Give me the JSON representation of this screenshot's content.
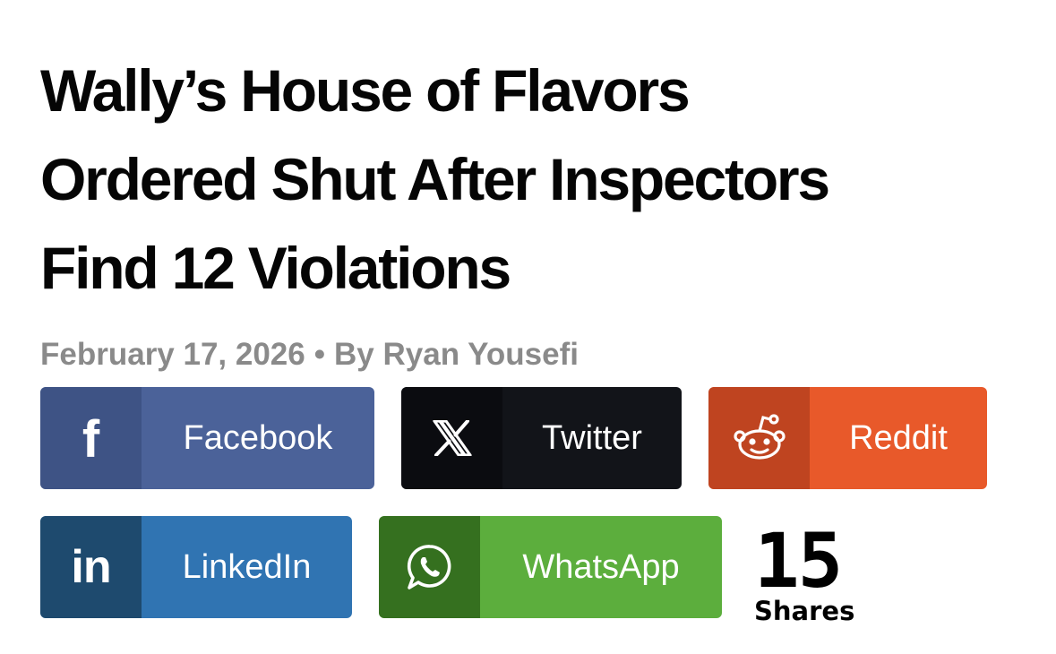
{
  "article": {
    "headline_lines": [
      "Wally’s House of Flavors",
      "Ordered Shut After Inspectors",
      "Find 12 Violations"
    ],
    "date": "February 17, 2026",
    "separator": "•",
    "byline": "By Ryan Yousefi"
  },
  "share": {
    "buttons": [
      {
        "label": "Facebook",
        "icon": "facebook-icon",
        "glyph": "f",
        "color": "#4b6299"
      },
      {
        "label": "Twitter",
        "icon": "x-twitter-icon",
        "color": "#121419"
      },
      {
        "label": "Reddit",
        "icon": "reddit-icon",
        "color": "#e8592a"
      },
      {
        "label": "LinkedIn",
        "icon": "linkedin-icon",
        "glyph": "in",
        "color": "#3074b2"
      },
      {
        "label": "WhatsApp",
        "icon": "whatsapp-icon",
        "color": "#5cae3d"
      }
    ],
    "count": "15",
    "count_label": "Shares"
  }
}
